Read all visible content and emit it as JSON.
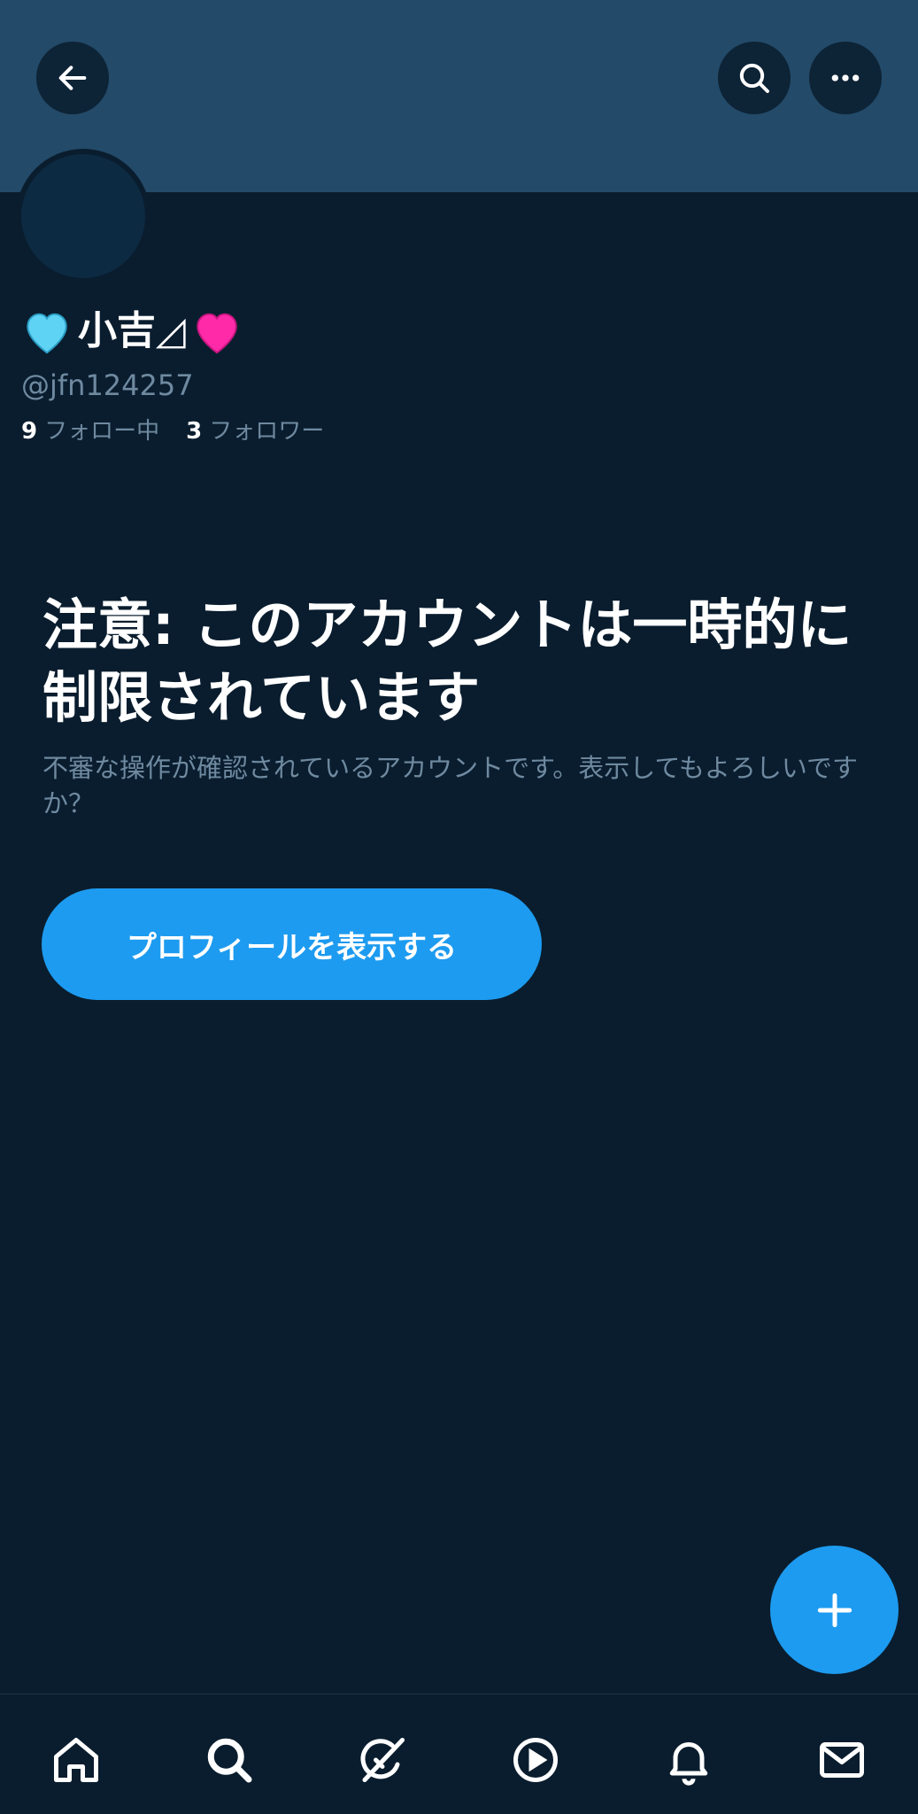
{
  "header": {
    "back_icon": "arrow-left-icon",
    "search_icon": "search-icon",
    "more_icon": "more-horizontal-icon"
  },
  "profile": {
    "name_prefix_emoji": "light-blue-heart-icon",
    "name": "小吉◿",
    "name_suffix_emoji": "pink-heart-icon",
    "handle": "@jfn124257",
    "following_count": "9",
    "following_label": "フォロー中",
    "followers_count": "3",
    "followers_label": "フォロワー"
  },
  "warning": {
    "title": "注意: このアカウントは一時的に制限されています",
    "description": "不審な操作が確認されているアカウントです。表示してもよろしいですか？",
    "button_label": "プロフィールを表示する"
  },
  "fab": {
    "icon": "plus-icon"
  },
  "tabs": [
    {
      "icon": "home-icon"
    },
    {
      "icon": "search-icon"
    },
    {
      "icon": "grok-icon"
    },
    {
      "icon": "play-icon"
    },
    {
      "icon": "bell-icon"
    },
    {
      "icon": "mail-icon"
    }
  ],
  "colors": {
    "background": "#0a1d2e",
    "banner": "#234a68",
    "accent": "#1d9bf0",
    "muted_text": "#6f8aa0"
  }
}
